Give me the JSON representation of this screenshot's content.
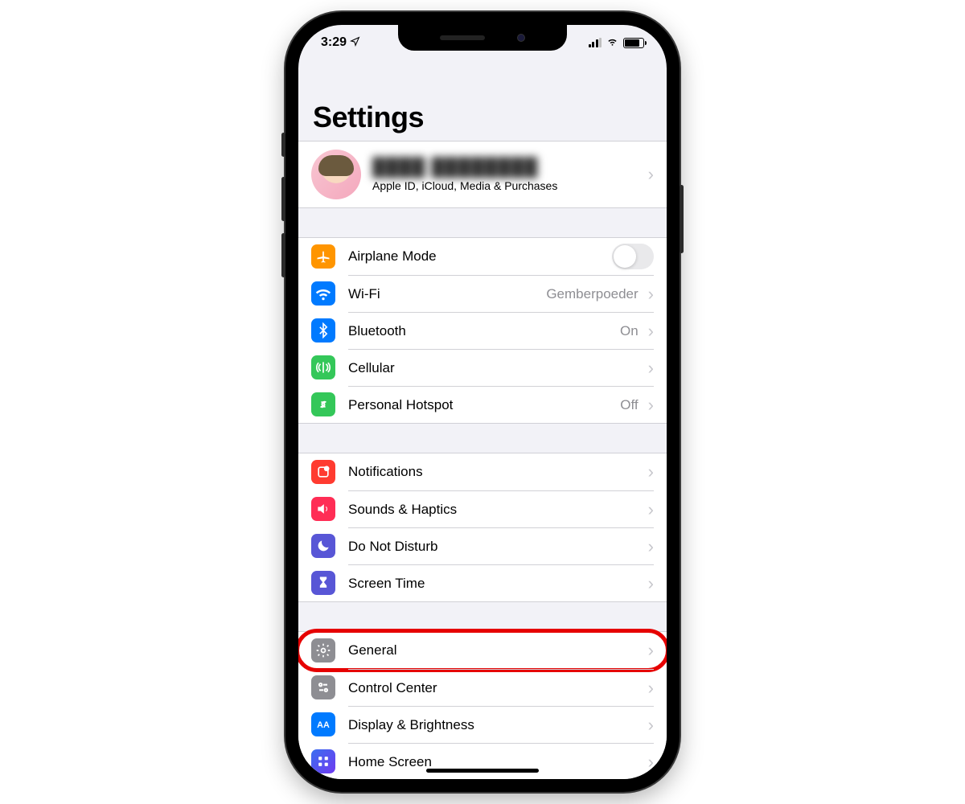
{
  "status": {
    "time": "3:29"
  },
  "title": "Settings",
  "profile": {
    "name": "████ ████████",
    "subtitle": "Apple ID, iCloud, Media & Purchases"
  },
  "group1": {
    "airplane": {
      "label": "Airplane Mode"
    },
    "wifi": {
      "label": "Wi-Fi",
      "value": "Gemberpoeder"
    },
    "bluetooth": {
      "label": "Bluetooth",
      "value": "On"
    },
    "cellular": {
      "label": "Cellular"
    },
    "hotspot": {
      "label": "Personal Hotspot",
      "value": "Off"
    }
  },
  "group2": {
    "notifications": {
      "label": "Notifications"
    },
    "sounds": {
      "label": "Sounds & Haptics"
    },
    "dnd": {
      "label": "Do Not Disturb"
    },
    "screentime": {
      "label": "Screen Time"
    }
  },
  "group3": {
    "general": {
      "label": "General"
    },
    "controlcenter": {
      "label": "Control Center"
    },
    "display": {
      "label": "Display & Brightness"
    },
    "homescreen": {
      "label": "Home Screen"
    }
  }
}
